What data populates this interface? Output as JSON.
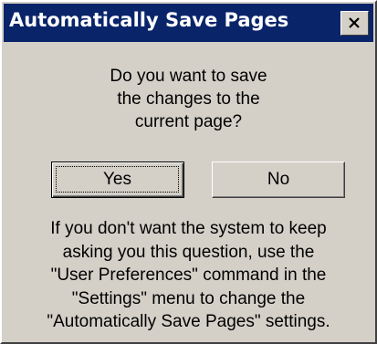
{
  "window": {
    "title": "Automatically Save Pages",
    "close_icon": "close-icon",
    "colors": {
      "titlebar": "#0a246a",
      "title_text": "#ffffff",
      "dialog_background": "#d4d0c8"
    }
  },
  "message": {
    "question_lines": [
      "Do you want to save",
      "the changes to the",
      "current page?"
    ],
    "info_lines": [
      "If you don't want the system to keep",
      "asking you this question, use the",
      "\"User Preferences\" command in the",
      "\"Settings\" menu to change the",
      "\"Automatically Save Pages\" settings."
    ]
  },
  "buttons": {
    "yes_label": "Yes",
    "no_label": "No"
  }
}
